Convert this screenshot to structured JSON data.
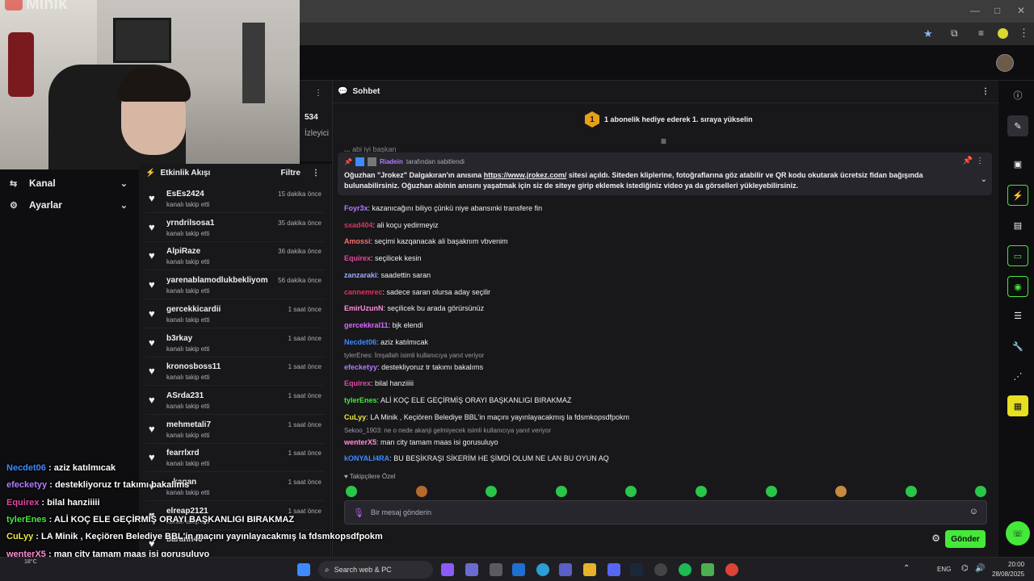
{
  "webcam": {
    "logo_text": "Minik"
  },
  "stats": {
    "count": "534",
    "label": "İzleyici"
  },
  "left_nav": {
    "items": [
      {
        "label": "Kanal"
      },
      {
        "label": "Ayarlar"
      }
    ]
  },
  "activity": {
    "title": "Etkinlik Akışı",
    "filter_label": "Filtre",
    "items": [
      {
        "user": "EsEs2424",
        "action": "kanalı takip etti",
        "time": "15 dakika önce"
      },
      {
        "user": "yrndrilsosa1",
        "action": "kanalı takip etti",
        "time": "35 dakika önce"
      },
      {
        "user": "AlpiRaze",
        "action": "kanalı takip etti",
        "time": "36 dakika önce"
      },
      {
        "user": "yarenablamodlukbekliyom",
        "action": "kanalı takip etti",
        "time": "56 dakika önce"
      },
      {
        "user": "gercekkicardii",
        "action": "kanalı takip etti",
        "time": "1 saat önce"
      },
      {
        "user": "b3rkay",
        "action": "kanalı takip etti",
        "time": "1 saat önce"
      },
      {
        "user": "kronosboss11",
        "action": "kanalı takip etti",
        "time": "1 saat önce"
      },
      {
        "user": "ASrda231",
        "action": "kanalı takip etti",
        "time": "1 saat önce"
      },
      {
        "user": "mehmetali7",
        "action": "kanalı takip etti",
        "time": "1 saat önce"
      },
      {
        "user": "fearrlxrd",
        "action": "kanalı takip etti",
        "time": "1 saat önce"
      },
      {
        "user": "...kagan",
        "action": "kanalı takip etti",
        "time": "1 saat önce"
      },
      {
        "user": "elreap2121",
        "action": "kanalı takip etti",
        "time": "1 saat önce"
      },
      {
        "user": "baranh46",
        "action": "",
        "time": ""
      }
    ]
  },
  "chat": {
    "title": "Sohbet",
    "sub_goal": {
      "rank": "1",
      "text": "1 abonelik hediye ederek 1. sıraya yükselin"
    },
    "cutoff_line": "abi iyi başkan",
    "pinned": {
      "pinned_by_user": "Riadein",
      "pinned_by_text": "tarafından sabitlendi",
      "text_before": "Oğuzhan \"Jrokez\" Dalgakıran'ın anısına ",
      "link": "https://www.jrokez.com/",
      "text_after": " sitesi açıldı. Siteden kliplerine, fotoğraflarına göz atabilir ve QR kodu okutarak ücretsiz fidan bağışında bulunabilirsiniz. Oğuzhan abinin anısını yaşatmak için siz de siteye girip eklemek istediğiniz video ya da görselleri yükleyebilirsiniz."
    },
    "messages": [
      {
        "user": "Foyr3x",
        "color": "#b37bff",
        "text": "kazanıcağını biliyo çünkü niye abansınki transfere fin"
      },
      {
        "user": "sxad404",
        "color": "#e0345a",
        "text": "ali koçu yedirmeyiz"
      },
      {
        "user": "Amossi",
        "color": "#ff6b6b",
        "text": "seçimi kazqanacak ali başaknım vbvenim"
      },
      {
        "user": "Equirex",
        "color": "#e04aa0",
        "text": "seçilicek kesin"
      },
      {
        "user": "zanzaraki",
        "color": "#9fa8ff",
        "text": "saadettin saran"
      },
      {
        "user": "cannemrec",
        "color": "#e0345a",
        "text": "sadece saran olursa aday seçilir"
      },
      {
        "user": "EmirUzunN",
        "color": "#ff8fd6",
        "text": "seçilicek bu arada görürsünüz"
      },
      {
        "user": "gercekkral11",
        "color": "#d96bff",
        "text": "bjk elendi"
      },
      {
        "user": "Necdet06",
        "color": "#3d8bff",
        "text": "aziz katılmıcak"
      },
      {
        "reply": "tylerEnes: İmşallah isimli kullanıcıya yanıt veriyor",
        "user": "efecketyy",
        "color": "#b37bff",
        "text": "destekliyoruz tr takımı bakalıms"
      },
      {
        "user": "Equirex",
        "color": "#e04aa0",
        "text": "bilal hanziiiii"
      },
      {
        "user": "tylerEnes",
        "color": "#45e93a",
        "text": "ALİ KOÇ ELE GEÇİRMİŞ ORAYI BAŞKANLIGI BIRAKMAZ"
      },
      {
        "user": "CuLyy",
        "color": "#e8e840",
        "text": "LA Minik , Keçiören Belediye BBL'in maçını yayınlayacakmış la fdsmkopsdfpokm"
      },
      {
        "reply": "Sekoo_1903: ne o nede akanji gelmiyecek isimli kullanıcıya yanıt veriyor",
        "user": "wenterX5",
        "color": "#ff8fd6",
        "text": "man city tamam maas isi gorusuluyo"
      },
      {
        "user": "kONYALI4RA",
        "color": "#3d8bff",
        "text": "BU BEŞİKRAŞI SİKERİM HE ŞİMDİ OLUM NE LAN BU OYUN AQ"
      }
    ],
    "followers_only_label": "Takipçilere Özel",
    "input_placeholder": "Bir mesaj gönderin",
    "send_label": "Gönder"
  },
  "overlay_chat": [
    {
      "user": "Necdet06",
      "color": "#3d8bff",
      "text": "aziz katılmıcak"
    },
    {
      "user": "efecketyy",
      "color": "#b37bff",
      "text": "destekliyoruz tr takımı bakalıms"
    },
    {
      "user": "Equirex",
      "color": "#e04aa0",
      "text": "bilal hanziiiii"
    },
    {
      "user": "tylerEnes",
      "color": "#45e93a",
      "text": "ALİ KOÇ ELE GEÇİRMİŞ ORAYI BAŞKANLIGI BIRAKMAZ"
    },
    {
      "user": "CuLyy",
      "color": "#e8e840",
      "text": "LA Minik , Keçiören Belediye BBL'in maçını yayınlayacakmış la fdsmkopsdfpokm"
    },
    {
      "user": "wenterX5",
      "color": "#ff8fd6",
      "text": "man city tamam maas isi gorusuluyo"
    },
    {
      "user": "kONYALI4RA",
      "color": "#3d8bff",
      "text": "BU BEŞİKRAŞI SİKERİM HE ŞİMDİ OLUM NE LAN BU OYUN AQ"
    }
  ],
  "taskbar": {
    "temperature": "18°C",
    "search_placeholder": "Search web & PC",
    "language": "ENG",
    "time": "20:00",
    "date": "28/08/2025"
  },
  "colors": {
    "accent": "#45e93a",
    "panel": "#18181b",
    "background": "#0e0e10"
  }
}
